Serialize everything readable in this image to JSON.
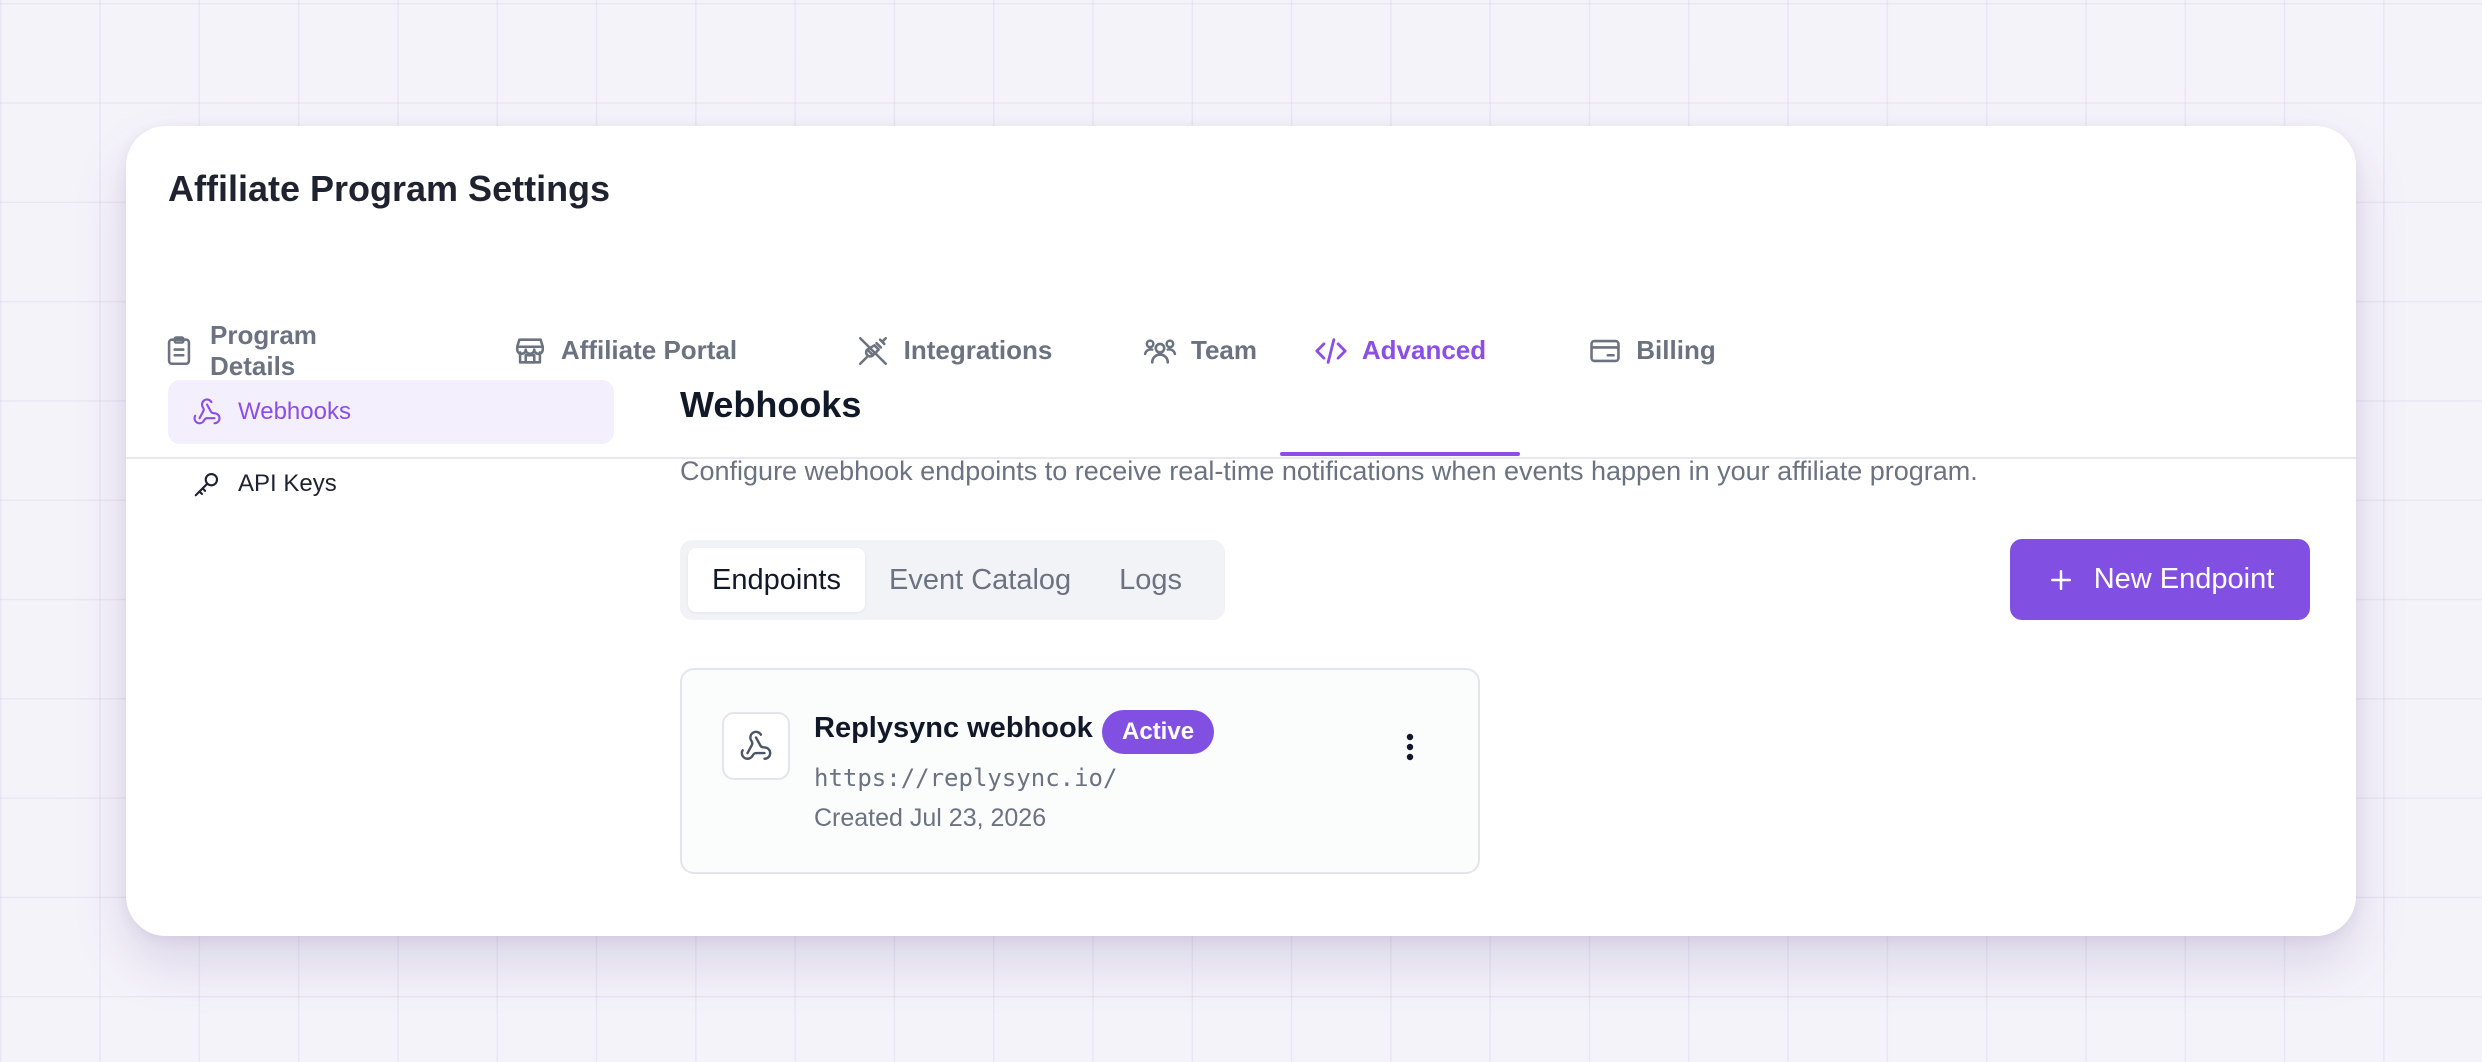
{
  "page": {
    "title": "Affiliate Program Settings"
  },
  "tabs": [
    {
      "label": "Program Details",
      "icon": "clipboard-icon",
      "active": false
    },
    {
      "label": "Affiliate Portal",
      "icon": "storefront-icon",
      "active": false
    },
    {
      "label": "Integrations",
      "icon": "plug-icon",
      "active": false
    },
    {
      "label": "Team",
      "icon": "users-icon",
      "active": false
    },
    {
      "label": "Advanced",
      "icon": "code-icon",
      "active": true
    },
    {
      "label": "Billing",
      "icon": "credit-card-icon",
      "active": false
    }
  ],
  "sidebar": {
    "items": [
      {
        "label": "Webhooks",
        "icon": "webhook-icon",
        "active": true
      },
      {
        "label": "API Keys",
        "icon": "key-icon",
        "active": false
      }
    ]
  },
  "main": {
    "title": "Webhooks",
    "description": "Configure webhook endpoints to receive real-time notifications when events happen in your affiliate program.",
    "segments": [
      {
        "label": "Endpoints",
        "active": true
      },
      {
        "label": "Event Catalog",
        "active": false
      },
      {
        "label": "Logs",
        "active": false
      }
    ],
    "new_button_label": "New Endpoint"
  },
  "endpoints": [
    {
      "name": "Replysync webhook",
      "status": "Active",
      "url": "https://replysync.io/",
      "created": "Created Jul 23, 2026"
    }
  ],
  "colors": {
    "accent": "#8150e2",
    "accent_text": "#8b4ee6",
    "muted_text": "#6b7280",
    "heading_text": "#111827"
  }
}
